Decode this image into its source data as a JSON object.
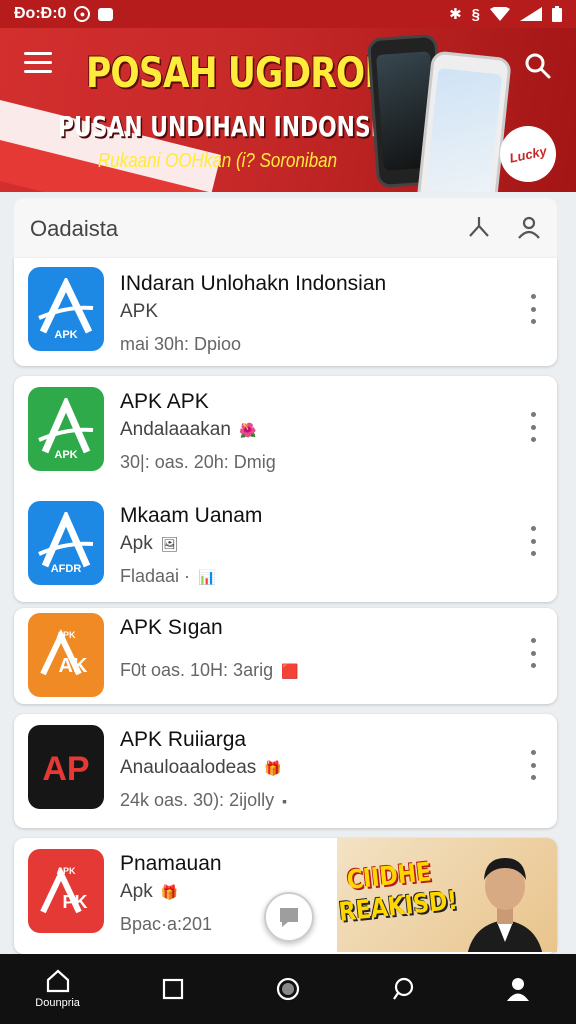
{
  "status_bar": {
    "time": "Đo:Đ:0"
  },
  "banner": {
    "title": "POSAH UGDROM",
    "subtitle": "PUSAN UNDIHAN INDONSIA",
    "tagline": "Rukaani OOHkan (i? Soroniban",
    "badge": "Lucky"
  },
  "section": {
    "title": "Oadaista"
  },
  "apps": [
    {
      "name": "INdaran Unlohakn Indonsian",
      "sub": "APK",
      "meta": "mai 30h: Dpioo",
      "icon_text": "APK",
      "icon_color": "#1e88e5"
    },
    {
      "name": "APK APK",
      "sub": "Andalaaakan",
      "meta": "30|: oas. 20h: Dmig",
      "icon_text": "APK",
      "icon_color": "#2eaa4a"
    },
    {
      "name": "Mkaam Uanam",
      "sub": "Apk",
      "meta": "Fladaai ·",
      "icon_text": "AFDR",
      "icon_color": "#1e88e5"
    },
    {
      "name": "APK Sıgan",
      "sub": "",
      "meta": "F0t oas. 10H: 3arig",
      "icon_text": "APK",
      "icon_color": "#f08a24"
    },
    {
      "name": "APK Ruiiarga",
      "sub": "Anauloaalodeas",
      "meta": "24k oas. 30): 2ijolly",
      "icon_text": "AP",
      "icon_color": "#161616"
    },
    {
      "name": "Pnamauan",
      "sub": "Apk",
      "meta": "Bpac·a:201",
      "icon_text": "APK",
      "icon_color": "#e53935"
    }
  ],
  "promo": {
    "line1": "CIIDHE",
    "line2": "REAKISD!"
  },
  "bottom_nav": [
    {
      "label": "Dounpria",
      "icon": "home-icon"
    },
    {
      "label": "",
      "icon": "square-icon"
    },
    {
      "label": "",
      "icon": "circle-icon"
    },
    {
      "label": "",
      "icon": "chat-icon"
    },
    {
      "label": "",
      "icon": "person-icon"
    }
  ]
}
